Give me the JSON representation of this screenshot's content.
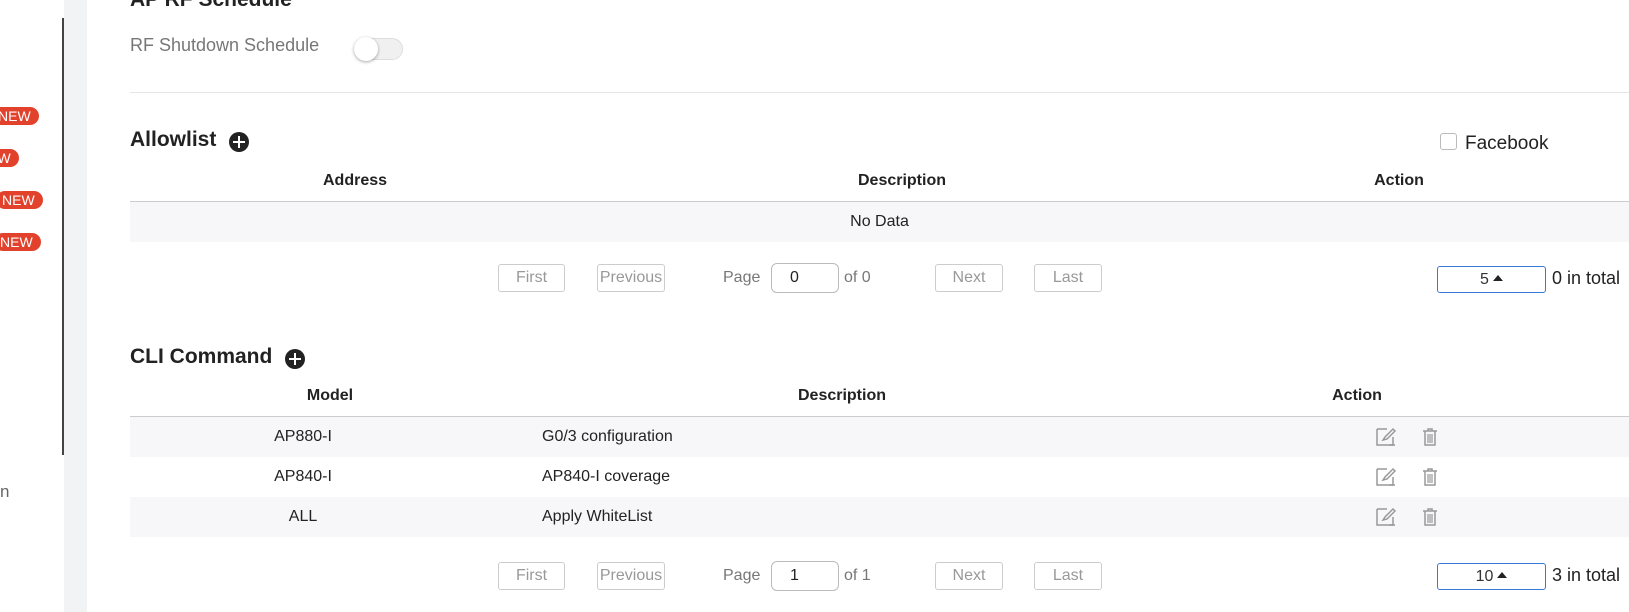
{
  "sidebar": {
    "badges": [
      "NEW",
      "NEW",
      "NEW",
      "NEW"
    ],
    "trailing_text": "n"
  },
  "rf_schedule": {
    "heading": "AP RF Schedule",
    "shutdown_label": "RF Shutdown Schedule",
    "shutdown_enabled": false
  },
  "allowlist": {
    "heading": "Allowlist",
    "facebook_label": "Facebook",
    "facebook_checked": false,
    "columns": [
      "Address",
      "Description",
      "Action"
    ],
    "empty_text": "No Data",
    "pagination": {
      "first": "First",
      "previous": "Previous",
      "page_label": "Page",
      "page_value": "0",
      "of_text": "of 0",
      "next": "Next",
      "last": "Last",
      "page_size": "5",
      "total": "0 in total"
    }
  },
  "cli": {
    "heading": "CLI Command",
    "columns": [
      "Model",
      "Description",
      "Action"
    ],
    "rows": [
      {
        "model": "AP880-I",
        "description": "G0/3 configuration"
      },
      {
        "model": "AP840-I",
        "description": "AP840-I coverage"
      },
      {
        "model": "ALL",
        "description": "Apply WhiteList"
      }
    ],
    "pagination": {
      "first": "First",
      "previous": "Previous",
      "page_label": "Page",
      "page_value": "1",
      "of_text": "of 1",
      "next": "Next",
      "last": "Last",
      "page_size": "10",
      "total": "3 in total"
    }
  },
  "icons": {
    "add": "plus-circle-icon",
    "edit": "edit-icon",
    "delete": "trash-icon",
    "caret": "caret-up-icon"
  },
  "colors": {
    "badge": "#e2422c",
    "select_border": "#3a78d8",
    "row_alt": "#f7f7f9"
  }
}
